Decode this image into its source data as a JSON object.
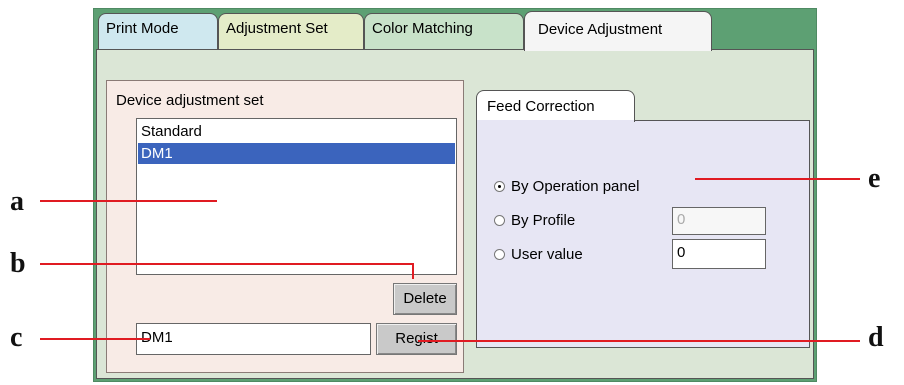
{
  "tabs": [
    {
      "label": "Print Mode",
      "color": "#cfe8ef"
    },
    {
      "label": "Adjustment Set",
      "color": "#e4ecc8"
    },
    {
      "label": "Color Matching",
      "color": "#c8e2c9"
    },
    {
      "label": "Device Adjustment",
      "color": "#f5f5f5",
      "active": true
    }
  ],
  "device_adjustment_set": {
    "title": "Device adjustment set",
    "items": [
      "Standard",
      "DM1"
    ],
    "selected": "DM1",
    "delete_label": "Delete",
    "name_value": "DM1",
    "regist_label": "Regist"
  },
  "feed_correction": {
    "tab_label": "Feed Correction",
    "options": [
      {
        "label": "By Operation panel",
        "checked": true
      },
      {
        "label": "By Profile",
        "checked": false,
        "value": "0",
        "disabled": true
      },
      {
        "label": "User value",
        "checked": false,
        "value": "0"
      }
    ]
  },
  "callouts": {
    "a": "a",
    "b": "b",
    "c": "c",
    "d": "d",
    "e": "e"
  },
  "colors": {
    "callout_line": "#e01b22",
    "window_bg": "#5da073",
    "selection": "#3b64bd"
  }
}
